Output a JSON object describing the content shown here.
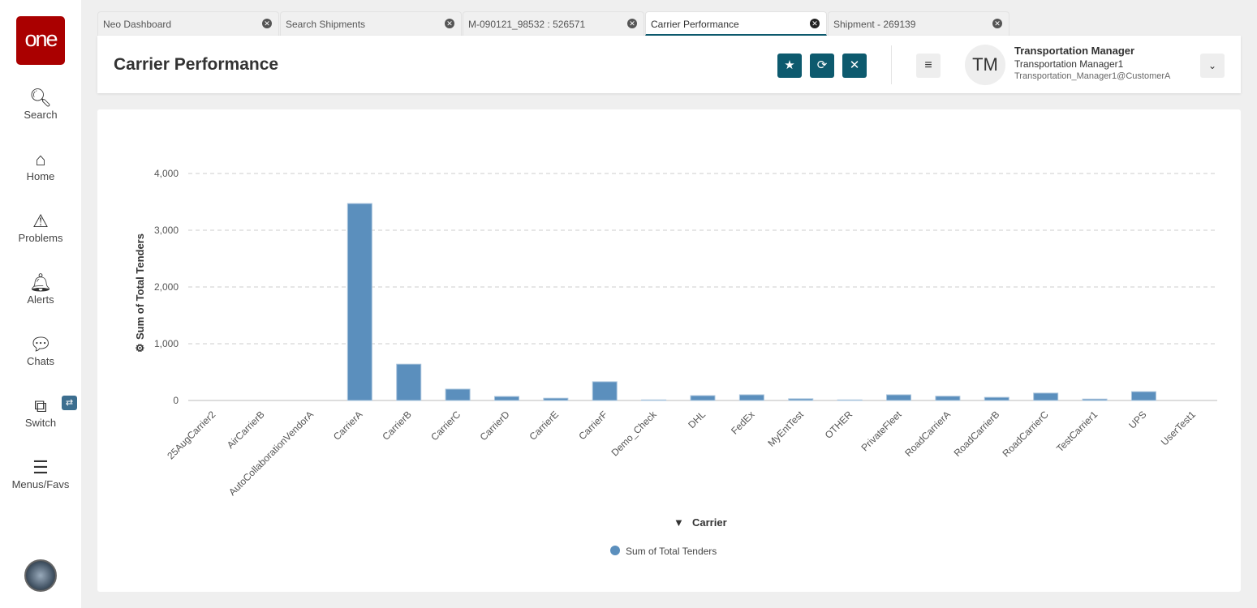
{
  "sidebar": {
    "logo": "one",
    "items": [
      {
        "label": "Search",
        "icon": "search-icon"
      },
      {
        "label": "Home",
        "icon": "home-icon"
      },
      {
        "label": "Problems",
        "icon": "warning-icon"
      },
      {
        "label": "Alerts",
        "icon": "bell-icon"
      },
      {
        "label": "Chats",
        "icon": "chat-icon"
      },
      {
        "label": "Switch",
        "icon": "switch-icon"
      },
      {
        "label": "Menus/Favs",
        "icon": "menu-icon"
      }
    ]
  },
  "tabs": [
    {
      "label": "Neo Dashboard"
    },
    {
      "label": "Search Shipments"
    },
    {
      "label": "M-090121_98532 : 526571"
    },
    {
      "label": "Carrier Performance",
      "active": true
    },
    {
      "label": "Shipment - 269139"
    }
  ],
  "header": {
    "title": "Carrier Performance",
    "user_initials": "TM",
    "user_name": "Transportation Manager",
    "user_role": "Transportation Manager1",
    "user_email": "Transportation_Manager1@CustomerA"
  },
  "colors": {
    "accent": "#0d5a6e",
    "bar": "#5b8fbd",
    "logo": "#aa0000"
  },
  "chart_data": {
    "type": "bar",
    "title": "",
    "xlabel": "Carrier",
    "ylabel": "Sum of Total Tenders",
    "ylim": [
      0,
      4000
    ],
    "yticks": [
      0,
      1000,
      2000,
      3000,
      4000
    ],
    "ytick_labels": [
      "0",
      "1,000",
      "2,000",
      "3,000",
      "4,000"
    ],
    "grid": true,
    "legend": "bottom-center",
    "categories": [
      "25AugCarrier2",
      "AirCarrierB",
      "AutoCollaborationVendorA",
      "CarrierA",
      "CarrierB",
      "CarrierC",
      "CarrierD",
      "CarrierE",
      "CarrierF",
      "Demo_Check",
      "DHL",
      "FedEx",
      "MyEntTest",
      "OTHER",
      "PrivateFleet",
      "RoadCarrierA",
      "RoadCarrierB",
      "RoadCarrierC",
      "TestCarrier1",
      "UPS",
      "UserTest1"
    ],
    "series": [
      {
        "name": "Sum of Total Tenders",
        "values": [
          0,
          0,
          0,
          3470,
          640,
          200,
          70,
          40,
          330,
          10,
          85,
          100,
          30,
          10,
          100,
          75,
          55,
          130,
          25,
          155,
          0
        ]
      }
    ]
  }
}
